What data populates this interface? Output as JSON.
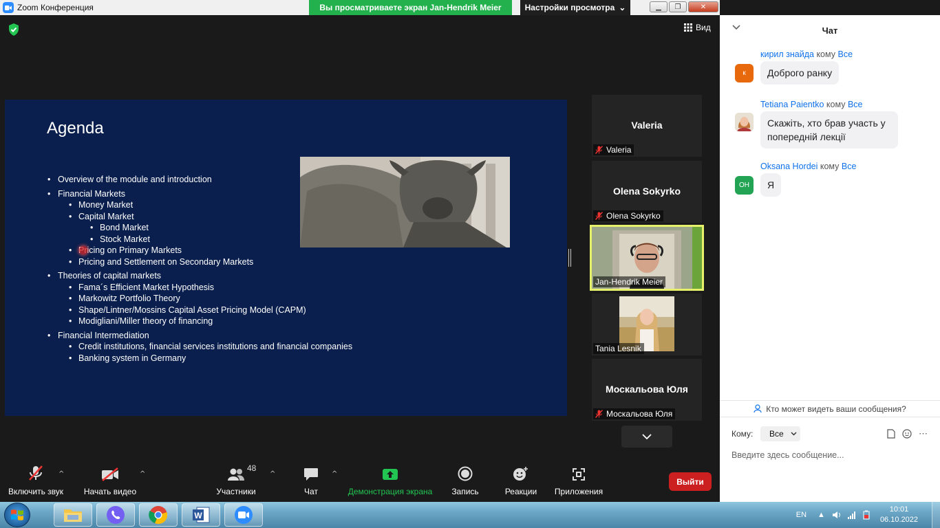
{
  "window": {
    "title": "Zoom Конференция",
    "share_banner": "Вы просматриваете экран Jan-Hendrik Meier",
    "view_settings": "Настройки просмотра",
    "view_button": "Вид"
  },
  "slide": {
    "title": "Agenda",
    "items": [
      {
        "level": 1,
        "text": "Overview of the module and introduction"
      },
      {
        "level": 1,
        "text": "Financial Markets"
      },
      {
        "level": 2,
        "text": "Money Market"
      },
      {
        "level": 2,
        "text": "Capital Market"
      },
      {
        "level": 3,
        "text": "Bond Market"
      },
      {
        "level": 3,
        "text": "Stock Market"
      },
      {
        "level": 2,
        "text": "Pricing on Primary Markets"
      },
      {
        "level": 2,
        "text": "Pricing and Settlement on Secondary Markets"
      },
      {
        "level": 1,
        "text": "Theories of capital markets"
      },
      {
        "level": 2,
        "text": "Fama´s Efficient Market Hypothesis"
      },
      {
        "level": 2,
        "text": "Markowitz Portfolio Theory"
      },
      {
        "level": 2,
        "text": "Shape/Lintner/Mossins Capital Asset Pricing Model (CAPM)"
      },
      {
        "level": 2,
        "text": "Modigliani/Miller theory of financing"
      },
      {
        "level": 1,
        "text": "Financial Intermediation"
      },
      {
        "level": 2,
        "text": "Credit institutions, financial services institutions and financial companies"
      },
      {
        "level": 2,
        "text": "Banking system in Germany"
      }
    ]
  },
  "participants": {
    "tiles": [
      {
        "name": "Valeria",
        "label": "Valeria"
      },
      {
        "name": "Olena Sokyrko",
        "label": "Olena Sokyrko"
      },
      {
        "label": "Jan-Hendrik Meier"
      },
      {
        "label": "Tania Lesnik"
      },
      {
        "name": "Москальова Юля",
        "label": "Москальова Юля"
      }
    ]
  },
  "toolbar": {
    "mute": "Включить звук",
    "video": "Начать видео",
    "participants": "Участники",
    "participants_count": "48",
    "chat": "Чат",
    "share": "Демонстрация экрана",
    "record": "Запись",
    "reactions": "Реакции",
    "apps": "Приложения",
    "leave": "Выйти"
  },
  "chat": {
    "title": "Чат",
    "to_word": "кому",
    "messages": [
      {
        "sender": "кирил знайда",
        "to": "Все",
        "avatar": "к",
        "avatar_color": "#e8680c",
        "text": "Доброго ранку"
      },
      {
        "sender": "Tetiana Paientko",
        "to": "Все",
        "avatar": "",
        "avatar_color": "#c9a37c",
        "text": "Скажіть, хто брав участь у попередній лекції"
      },
      {
        "sender": "Oksana Hordei",
        "to": "Все",
        "avatar": "OH",
        "avatar_color": "#23a455",
        "text": "Я"
      }
    ],
    "who_sees": "Кто может видеть ваши сообщения?",
    "to_label": "Кому:",
    "to_value": "Все",
    "input_placeholder": "Введите здесь сообщение..."
  },
  "taskbar": {
    "language": "EN",
    "time": "10:01",
    "date": "06.10.2022"
  },
  "colors": {
    "share_green": "#22b14c",
    "slide_bg": "#0a1f4d",
    "leave_red": "#cc1f1f",
    "chat_link": "#0e71eb",
    "active_speaker": "#e6f06b"
  }
}
